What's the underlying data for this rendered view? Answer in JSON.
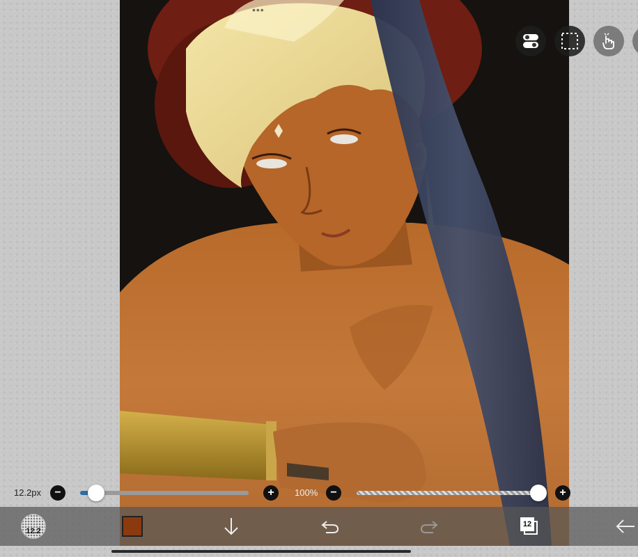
{
  "app": {
    "handle_icon": "more-dots-icon"
  },
  "top_tools": [
    {
      "name": "layer-toggle-button",
      "icon": "toggle-switches-icon"
    },
    {
      "name": "selection-button",
      "icon": "dashed-selection-icon"
    },
    {
      "name": "hand-tool-button",
      "icon": "hand-pointer-icon"
    }
  ],
  "brush_size": {
    "label": "12.2px",
    "level": 0.06
  },
  "opacity": {
    "label": "100%",
    "level": 1.0
  },
  "toolbar": {
    "brush_label": "12.2",
    "current_color": "#8b3a10",
    "layer_number": "12"
  },
  "colors": {
    "toolbar_bg": "#585858",
    "slider_accent": "#2d6fa8",
    "canvas_bg": "#15120f"
  }
}
